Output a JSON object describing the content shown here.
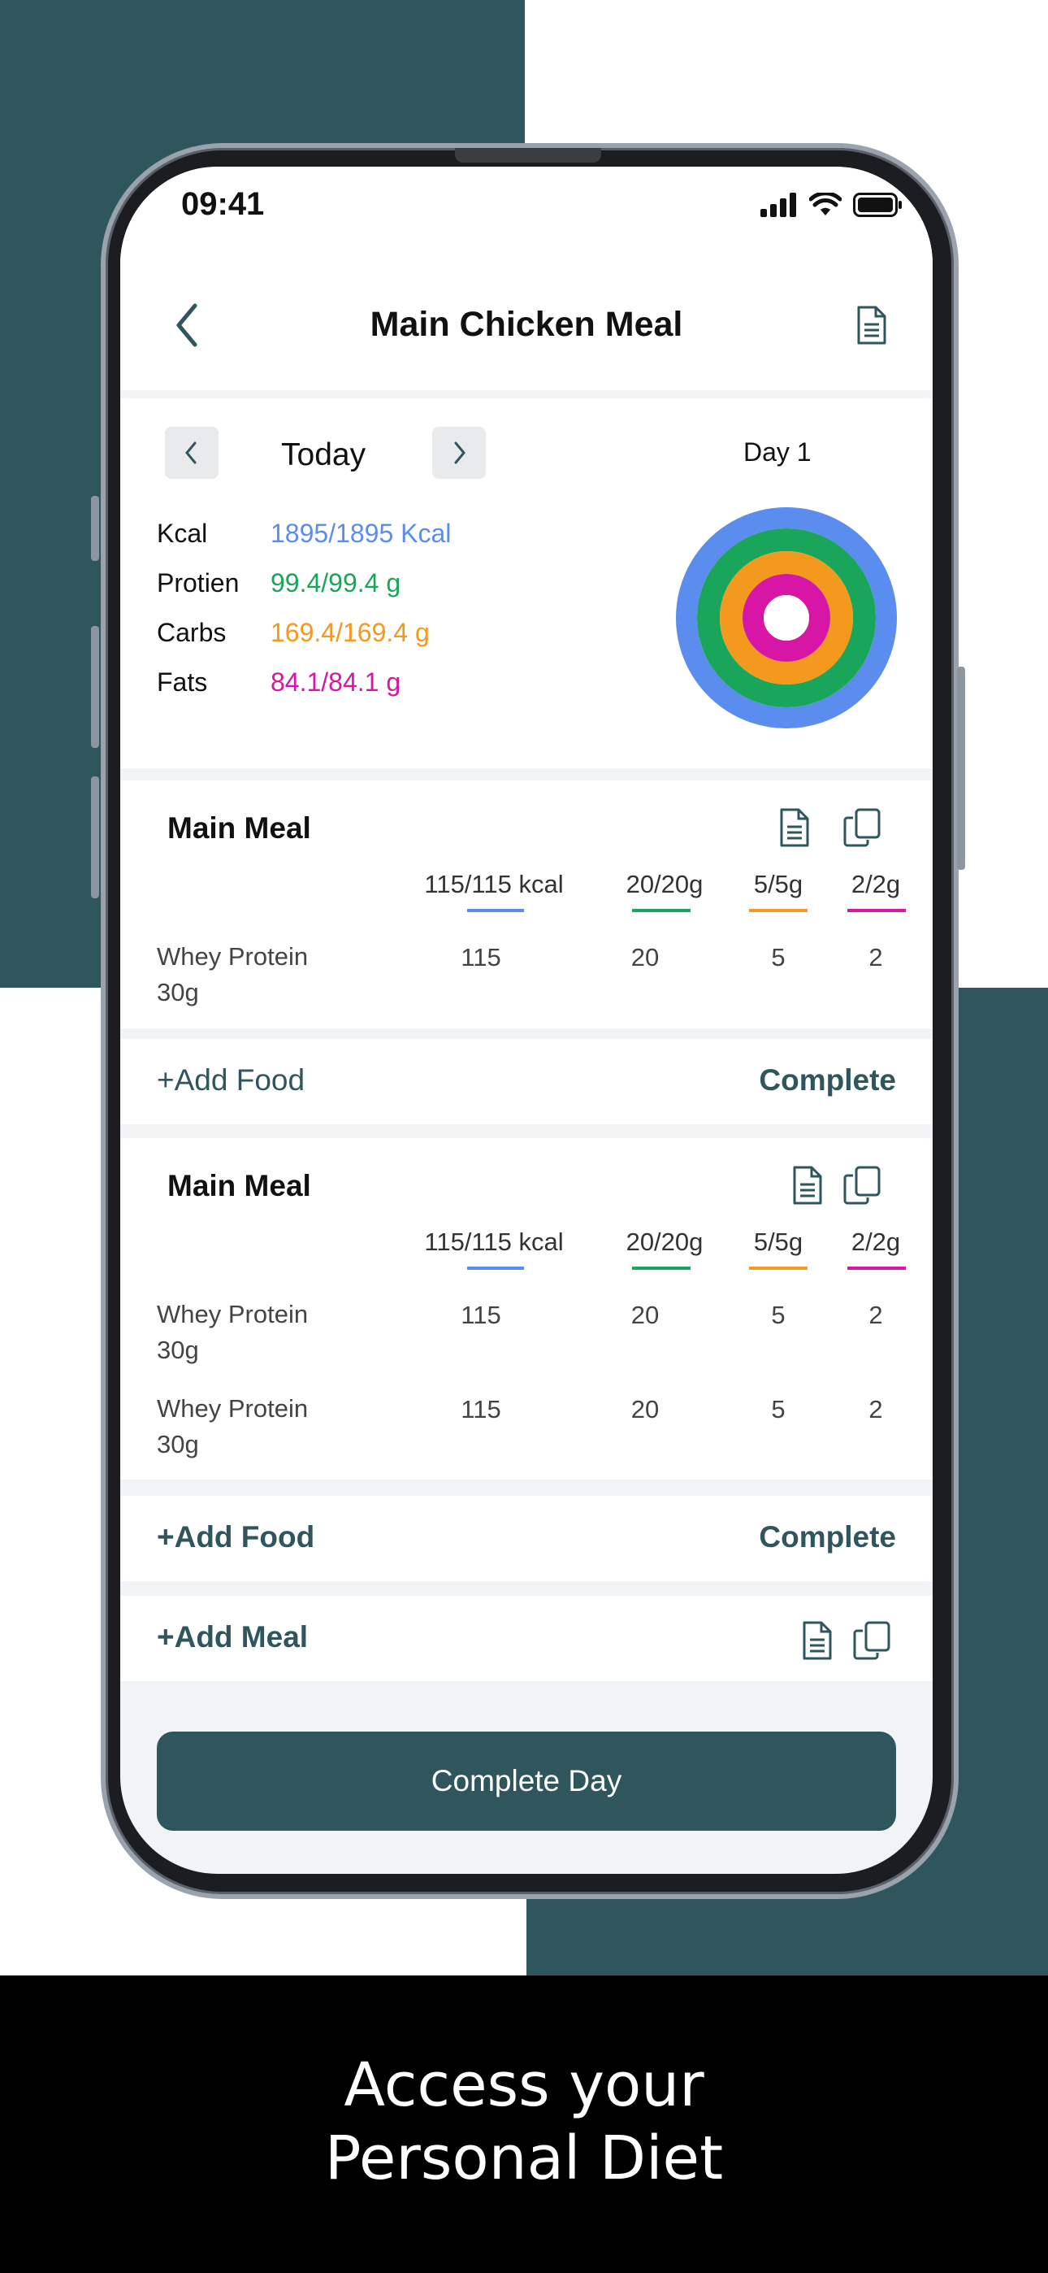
{
  "status_bar": {
    "time": "09:41"
  },
  "header": {
    "title": "Main Chicken Meal"
  },
  "day_nav": {
    "label": "Today",
    "day_label": "Day 1"
  },
  "macros": [
    {
      "label": "Kcal",
      "value": "1895/1895 Kcal",
      "color": "#5b8def"
    },
    {
      "label": "Protien",
      "value": "99.4/99.4 g",
      "color": "#1aa65a"
    },
    {
      "label": "Carbs",
      "value": "169.4/169.4 g",
      "color": "#f39a1e"
    },
    {
      "label": "Fats",
      "value": "84.1/84.1 g",
      "color": "#d816a5"
    }
  ],
  "rings": {
    "kcal": 1.0,
    "protein": 1.0,
    "carbs": 1.0,
    "fats": 1.0
  },
  "meals": [
    {
      "title": "Main Meal",
      "header": [
        "115/115 kcal",
        "20/20g",
        "5/5g",
        "2/2g"
      ],
      "items": [
        {
          "name": "Whey Protein",
          "qty": "30g",
          "kcal": "115",
          "protein": "20",
          "carbs": "5",
          "fats": "2"
        }
      ],
      "add_label": "+Add Food",
      "complete_label": "Complete"
    },
    {
      "title": "Main Meal",
      "header": [
        "115/115 kcal",
        "20/20g",
        "5/5g",
        "2/2g"
      ],
      "items": [
        {
          "name": "Whey Protein",
          "qty": "30g",
          "kcal": "115",
          "protein": "20",
          "carbs": "5",
          "fats": "2"
        },
        {
          "name": "Whey Protein",
          "qty": "30g",
          "kcal": "115",
          "protein": "20",
          "carbs": "5",
          "fats": "2"
        }
      ],
      "add_label": "+Add Food",
      "complete_label": "Complete"
    }
  ],
  "add_meal_label": "+Add Meal",
  "cta_label": "Complete Day",
  "caption": {
    "line1": "Access your",
    "line2": "Personal Diet"
  },
  "colors": {
    "brand": "#2f565c",
    "kcal": "#5b8def",
    "protein": "#1aa65a",
    "carbs": "#f39a1e",
    "fats": "#d816a5"
  },
  "icons": [
    "back-chevron-icon",
    "document-icon",
    "copy-icon",
    "chevron-left-icon",
    "chevron-right-icon",
    "signal-icon",
    "wifi-icon",
    "battery-icon"
  ]
}
